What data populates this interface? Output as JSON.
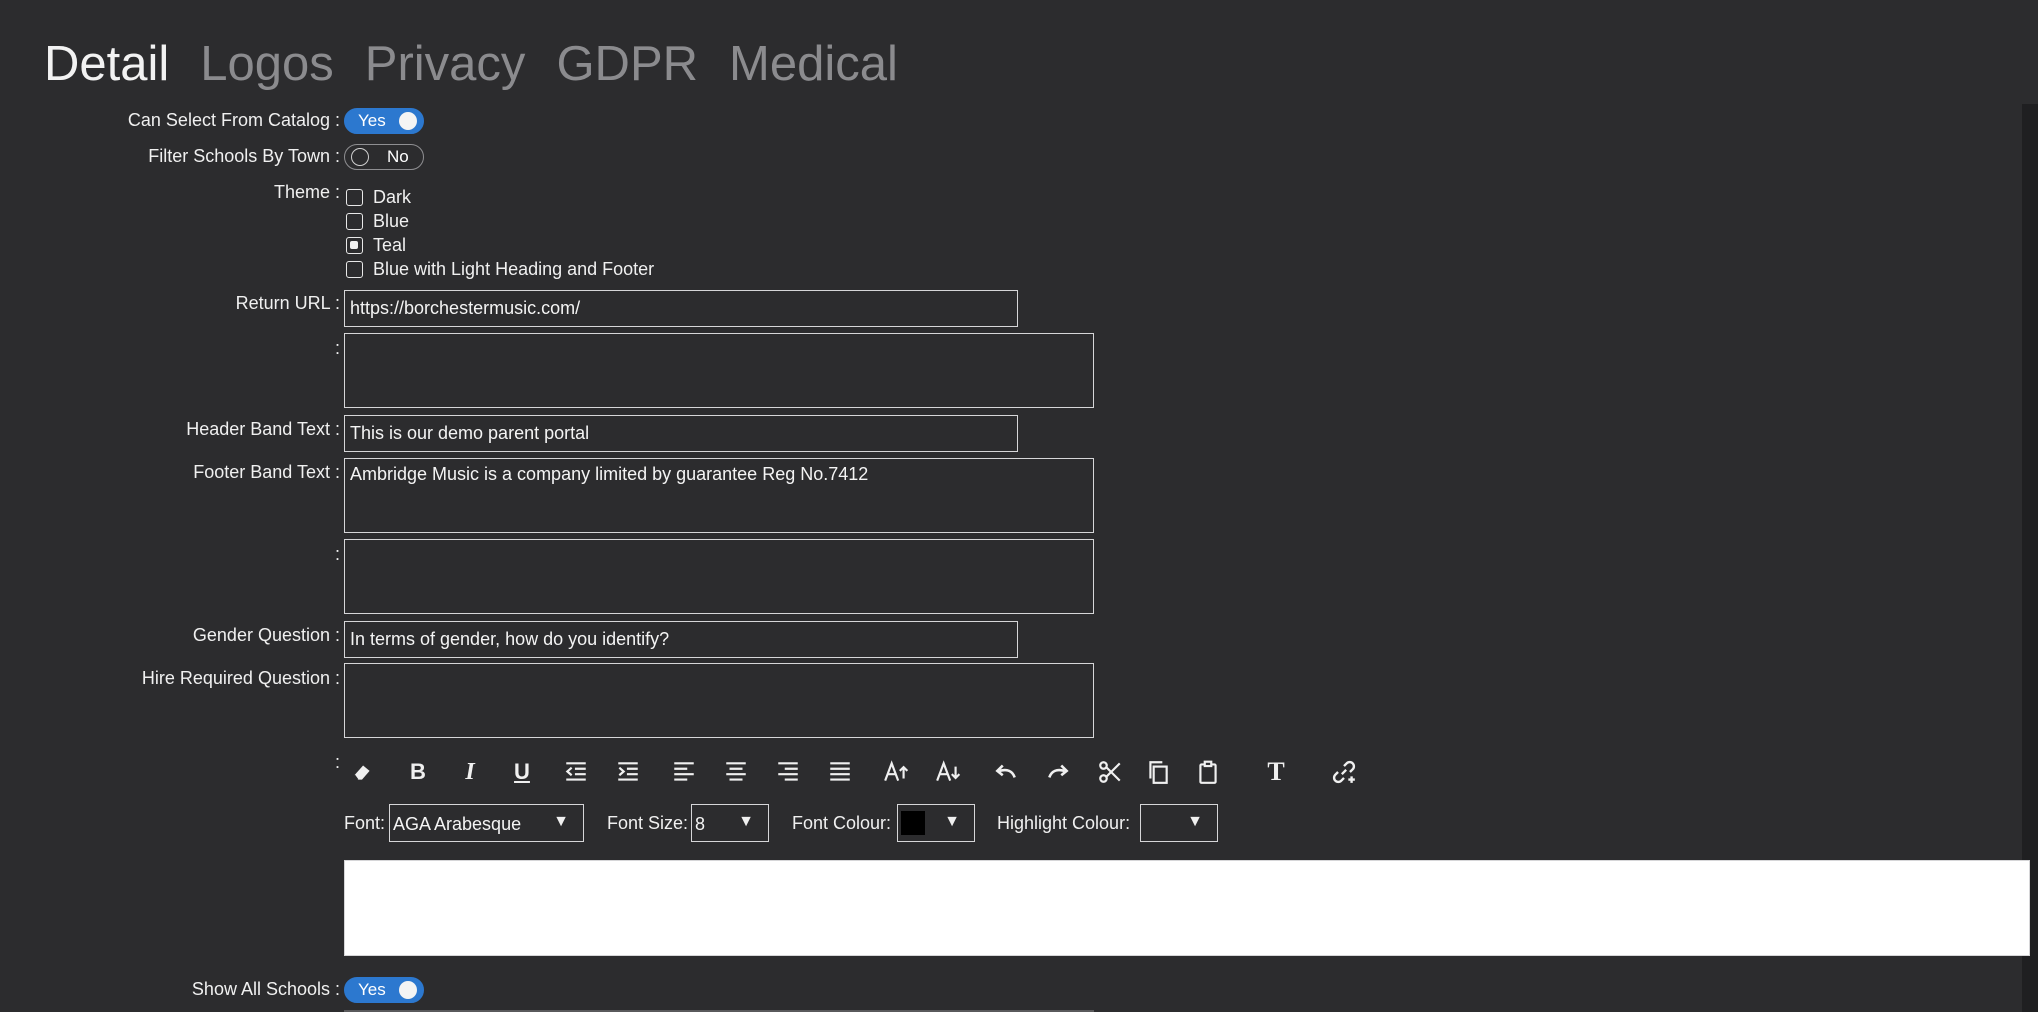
{
  "tabs": [
    {
      "label": "Detail",
      "active": true
    },
    {
      "label": "Logos",
      "active": false
    },
    {
      "label": "Privacy",
      "active": false
    },
    {
      "label": "GDPR",
      "active": false
    },
    {
      "label": "Medical",
      "active": false
    }
  ],
  "fields": {
    "can_select_catalog": {
      "label": "Can Select From Catalog :",
      "value": "Yes",
      "on": true
    },
    "filter_schools_by_town": {
      "label": "Filter Schools By Town :",
      "value": "No",
      "on": false
    },
    "theme": {
      "label": "Theme :",
      "options": [
        {
          "label": "Dark",
          "checked": false
        },
        {
          "label": "Blue",
          "checked": false
        },
        {
          "label": "Teal",
          "checked": true
        },
        {
          "label": "Blue with Light Heading and Footer",
          "checked": false
        }
      ]
    },
    "return_url": {
      "label": "Return URL :",
      "value": "https://borchestermusic.com/"
    },
    "unnamed_1": {
      "label": ":",
      "value": ""
    },
    "header_band_text": {
      "label": "Header Band Text :",
      "value": "This is our demo parent portal"
    },
    "footer_band_text": {
      "label": "Footer Band Text :",
      "value": "Ambridge Music is a company limited by guarantee Reg No.7412"
    },
    "unnamed_2": {
      "label": ":",
      "value": ""
    },
    "gender_question": {
      "label": "Gender Question :",
      "value": "In terms of gender, how do you identify?"
    },
    "hire_required_question": {
      "label": "Hire Required Question :",
      "value": ""
    },
    "rich_text_label": {
      "label": ":"
    },
    "show_all_schools": {
      "label": "Show All Schools :",
      "value": "Yes",
      "on": true
    }
  },
  "editor": {
    "toolbar_icons": [
      "eraser-icon",
      "bold-icon",
      "italic-icon",
      "underline-icon",
      "outdent-icon",
      "indent-icon",
      "align-left-icon",
      "align-center-icon",
      "align-right-icon",
      "justify-icon",
      "font-size-increase-icon",
      "font-size-decrease-icon",
      "undo-icon",
      "redo-icon",
      "cut-icon",
      "copy-icon",
      "paste-icon",
      "clear-format-icon",
      "link-icon"
    ],
    "font_label": "Font:",
    "font_value": "AGA Arabesque",
    "font_size_label": "Font Size:",
    "font_size_value": "8",
    "font_colour_label": "Font Colour:",
    "font_colour_value": "#000000",
    "highlight_colour_label": "Highlight Colour:",
    "arrow_glyph": "▼"
  },
  "colors": {
    "background": "#2c2c2e",
    "toggle_on": "#2c78cf",
    "tab_active": "#f2f2f2",
    "tab_inactive": "#8b8b8e"
  }
}
